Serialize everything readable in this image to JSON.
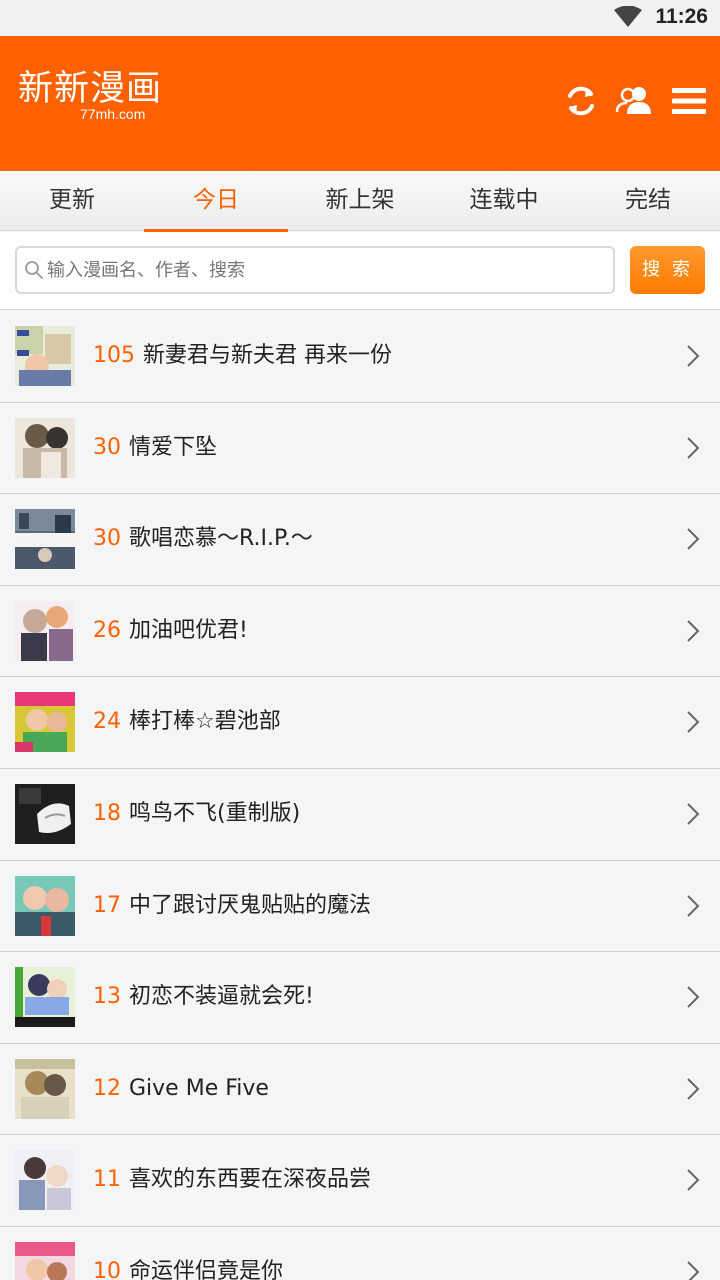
{
  "status_bar": {
    "time": "11:26"
  },
  "header": {
    "logo_title": "新新漫画",
    "logo_sub": "77mh.com"
  },
  "tabs": [
    {
      "label": "更新"
    },
    {
      "label": "今日"
    },
    {
      "label": "新上架"
    },
    {
      "label": "连载中"
    },
    {
      "label": "完结"
    }
  ],
  "active_tab": "今日",
  "search": {
    "placeholder": "输入漫画名、作者、搜索",
    "button_label": "搜 索"
  },
  "comics": [
    {
      "count": "105",
      "title": "新妻君与新夫君 再来一份"
    },
    {
      "count": "30",
      "title": "情爱下坠"
    },
    {
      "count": "30",
      "title": "歌唱恋慕～R.I.P.～"
    },
    {
      "count": "26",
      "title": "加油吧优君!"
    },
    {
      "count": "24",
      "title": "棒打棒☆碧池部"
    },
    {
      "count": "18",
      "title": "鸣鸟不飞(重制版)"
    },
    {
      "count": "17",
      "title": "中了跟讨厌鬼贴贴的魔法"
    },
    {
      "count": "13",
      "title": "初恋不装逼就会死!"
    },
    {
      "count": "12",
      "title": "Give Me Five"
    },
    {
      "count": "11",
      "title": "喜欢的东西要在深夜品尝"
    },
    {
      "count": "10",
      "title": "命运伴侣竟是你"
    }
  ],
  "colors": {
    "brand": "#ff6000",
    "search_button": "#ff7a00"
  }
}
